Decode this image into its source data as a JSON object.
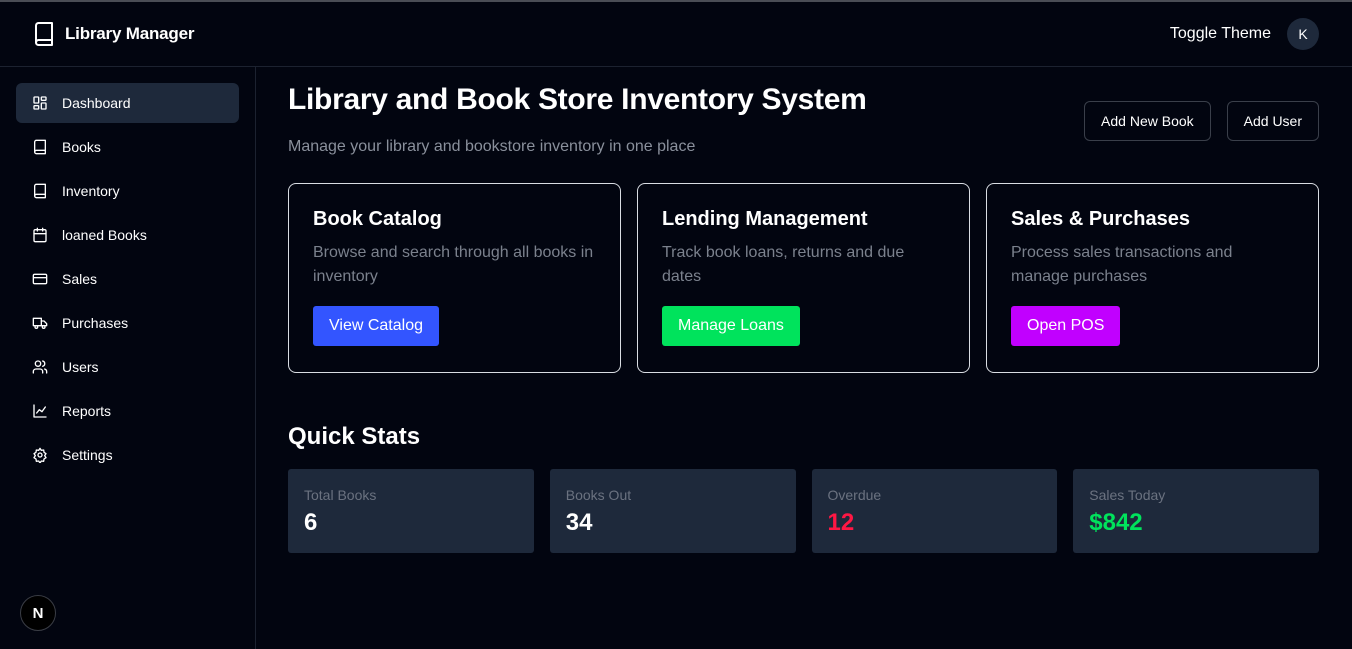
{
  "header": {
    "app_title": "Library Manager",
    "toggle_theme": "Toggle Theme",
    "avatar_initial": "K"
  },
  "sidebar": {
    "items": [
      {
        "label": "Dashboard",
        "icon": "dashboard-icon",
        "active": true
      },
      {
        "label": "Books",
        "icon": "book-icon"
      },
      {
        "label": "Inventory",
        "icon": "book-icon"
      },
      {
        "label": "loaned Books",
        "icon": "calendar-icon"
      },
      {
        "label": "Sales",
        "icon": "credit-card-icon"
      },
      {
        "label": "Purchases",
        "icon": "truck-icon"
      },
      {
        "label": "Users",
        "icon": "users-icon"
      },
      {
        "label": "Reports",
        "icon": "line-chart-icon"
      },
      {
        "label": "Settings",
        "icon": "gear-icon"
      }
    ],
    "badge": "N"
  },
  "main": {
    "title": "Library and Book Store Inventory System",
    "subtitle": "Manage your library and bookstore inventory in one place",
    "actions": {
      "add_book": "Add New Book",
      "add_user": "Add User"
    },
    "cards": [
      {
        "title": "Book Catalog",
        "description": "Browse and search through all books in inventory",
        "button": "View Catalog",
        "color": "#3355ff"
      },
      {
        "title": "Lending Management",
        "description": "Track book loans, returns and due dates",
        "button": "Manage Loans",
        "color": "#00e35c"
      },
      {
        "title": "Sales & Purchases",
        "description": "Process sales transactions and manage purchases",
        "button": "Open POS",
        "color": "#c100ff"
      }
    ],
    "stats_title": "Quick Stats",
    "stats": [
      {
        "label": "Total Books",
        "value": "6",
        "color": "#ffffff"
      },
      {
        "label": "Books Out",
        "value": "34",
        "color": "#ffffff"
      },
      {
        "label": "Overdue",
        "value": "12",
        "color": "#ff1744"
      },
      {
        "label": "Sales Today",
        "value": "$842",
        "color": "#00e35c"
      }
    ]
  }
}
